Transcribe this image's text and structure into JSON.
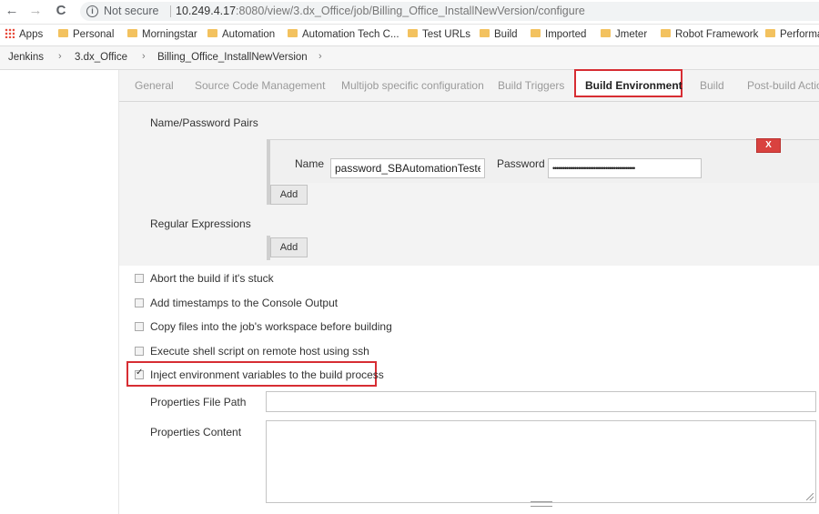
{
  "browser": {
    "nav": {
      "back": "←",
      "forward": "→",
      "reload": "C"
    },
    "security_label": "Not secure",
    "url_host": "10.249.4.17",
    "url_rest": ":8080/view/3.dx_Office/job/Billing_Office_InstallNewVersion/configure"
  },
  "bookmarks": [
    "Apps",
    "Personal",
    "Morningstar",
    "Automation",
    "Automation Tech C...",
    "Test URLs",
    "Build",
    "Imported",
    "Jmeter",
    "Robot Framework",
    "Performa"
  ],
  "breadcrumb": {
    "items": [
      "Jenkins",
      "3.dx_Office",
      "Billing_Office_InstallNewVersion"
    ],
    "separator": "›"
  },
  "tabs": [
    "General",
    "Source Code Management",
    "Multijob specific configuration",
    "Build Triggers",
    "Build Environment",
    "Build",
    "Post-build Action"
  ],
  "active_tab": "Build Environment",
  "env": {
    "name_password_pairs_label": "Name/Password Pairs",
    "name_label": "Name",
    "name_value": "password_SBAutomationTester",
    "password_label": "Password",
    "password_value": "••••••••••••••••••••••••••••••••••••••••••",
    "delete_label": "X",
    "add_label": "Add",
    "regex_label": "Regular Expressions"
  },
  "checkboxes": [
    {
      "label": "Abort the build if it's stuck",
      "checked": false
    },
    {
      "label": "Add timestamps to the Console Output",
      "checked": false
    },
    {
      "label": "Copy files into the job's workspace before building",
      "checked": false
    },
    {
      "label": "Execute shell script on remote host using ssh",
      "checked": false
    },
    {
      "label": "Inject environment variables to the build process",
      "checked": true
    }
  ],
  "inject": {
    "properties_file_path_label": "Properties File Path",
    "properties_file_path_value": "",
    "properties_content_label": "Properties Content",
    "properties_content_value": ""
  },
  "colors": {
    "highlight_red": "#d72d33",
    "delete_button": "#d9423f",
    "folder_icon": "#f3c25f"
  }
}
